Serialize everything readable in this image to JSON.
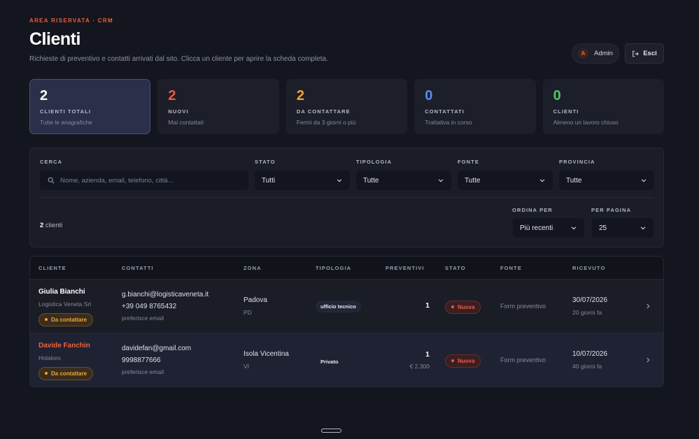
{
  "header": {
    "eyebrow": "AREA RISERVATA · CRM",
    "title": "Clienti",
    "subtitle": "Richieste di preventivo e contatti arrivati dal sito. Clicca un cliente per aprire la scheda completa.",
    "admin_initial": "A",
    "admin_label": "Admin",
    "logout_label": "Esci"
  },
  "stats": [
    {
      "value": "2",
      "label": "CLIENTI TOTALI",
      "desc": "Tutte le anagrafiche",
      "color": "#ffffff"
    },
    {
      "value": "2",
      "label": "NUOVI",
      "desc": "Mai contattati",
      "color": "#ec5a3f"
    },
    {
      "value": "2",
      "label": "DA CONTATTARE",
      "desc": "Fermi da 3 giorni o più",
      "color": "#f0a538"
    },
    {
      "value": "0",
      "label": "CONTATTATI",
      "desc": "Trattativa in corso",
      "color": "#5b8cf0"
    },
    {
      "value": "0",
      "label": "CLIENTI",
      "desc": "Almeno un lavoro chiuso",
      "color": "#4fc66a"
    }
  ],
  "filters": {
    "search_label": "CERCA",
    "search_placeholder": "Nome, azienda, email, telefono, città...",
    "stato_label": "STATO",
    "stato_value": "Tutti",
    "tipologia_label": "TIPOLOGIA",
    "tipologia_value": "Tutte",
    "fonte_label": "FONTE",
    "fonte_value": "Tutte",
    "provincia_label": "PROVINCIA",
    "provincia_value": "Tutte",
    "count_number": "2",
    "count_suffix": " clienti",
    "ordina_label": "ORDINA PER",
    "ordina_value": "Più recenti",
    "perpagina_label": "PER PAGINA",
    "perpagina_value": "25"
  },
  "table": {
    "headers": [
      "CLIENTE",
      "CONTATTI",
      "ZONA",
      "TIPOLOGIA",
      "PREVENTIVI",
      "STATO",
      "FONTE",
      "RICEVUTO"
    ],
    "rows": [
      {
        "name": "Giulia Bianchi",
        "company": "Logistica Veneta Srl",
        "badge": "Da contattare",
        "email": "g.bianchi@logisticaveneta.it",
        "phone": "+39 049 8765432",
        "pref": "preferisce email",
        "city": "Padova",
        "province": "PD",
        "tipologia": "ufficio tecnico",
        "preventivi": "1",
        "amount": "",
        "stato": "Nuova",
        "fonte": "Form preventivo",
        "date": "30/07/2026",
        "ago": "20 giorni fa"
      },
      {
        "name": "Davide Fanchin",
        "company": "Holaloro",
        "badge": "Da contattare",
        "email": "davidefan@gmail.com",
        "phone": "9998877666",
        "pref": "preferisce email",
        "city": "Isola Vicentina",
        "province": "VI",
        "tipologia": "Privato",
        "preventivi": "1",
        "amount": "€ 2.300",
        "stato": "Nuova",
        "fonte": "Form preventivo",
        "date": "10/07/2026",
        "ago": "40 giorni fa"
      }
    ]
  }
}
